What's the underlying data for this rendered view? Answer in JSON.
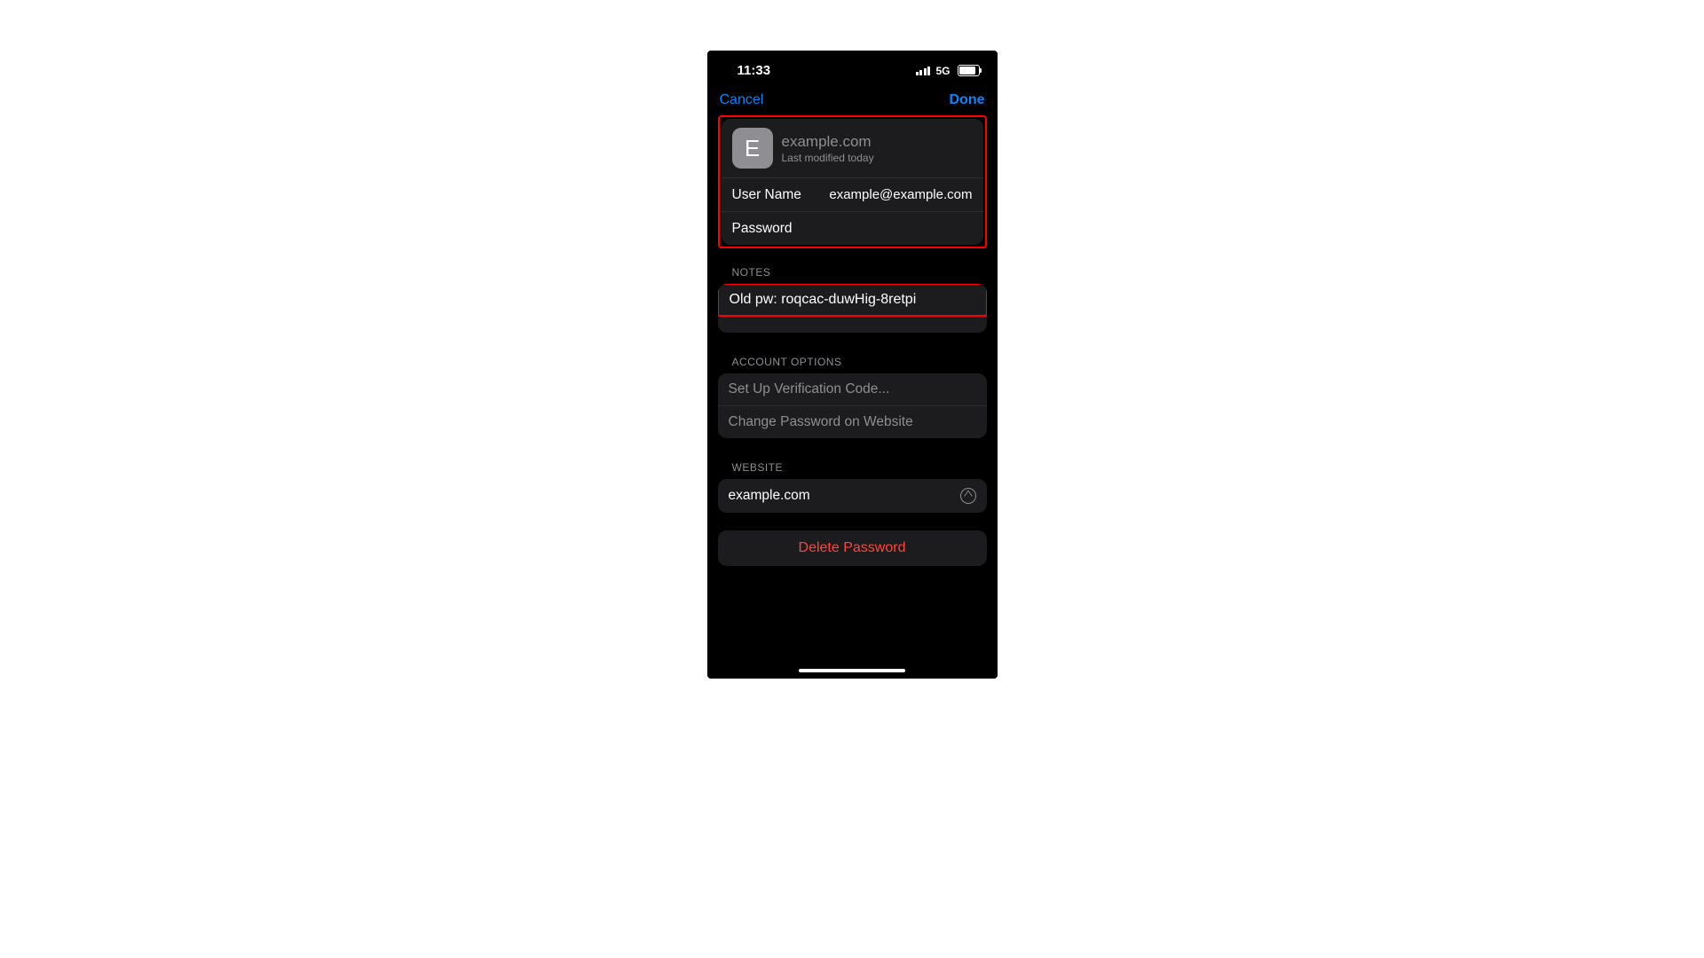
{
  "status": {
    "time": "11:33",
    "network": "5G"
  },
  "nav": {
    "cancel": "Cancel",
    "done": "Done"
  },
  "site": {
    "initial": "E",
    "title": "example.com",
    "subtitle": "Last modified today"
  },
  "credentials": {
    "username_label": "User Name",
    "username_value": "example@example.com",
    "password_label": "Password",
    "password_value": ""
  },
  "notes": {
    "header": "NOTES",
    "text": "Old pw: roqcac-duwHig-8retpi"
  },
  "account_options": {
    "header": "ACCOUNT OPTIONS",
    "setup_code": "Set Up Verification Code...",
    "change_password": "Change Password on Website"
  },
  "website": {
    "header": "WEBSITE",
    "value": "example.com"
  },
  "delete": {
    "label": "Delete Password"
  }
}
